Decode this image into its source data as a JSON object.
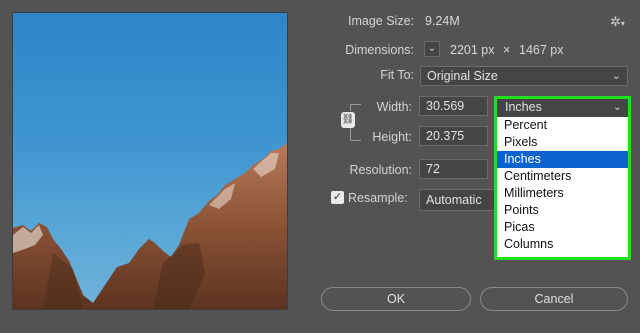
{
  "image_size": {
    "label": "Image Size:",
    "value": "9.24M"
  },
  "dimensions": {
    "label": "Dimensions:",
    "width": "2201 px",
    "times": "×",
    "height": "1467 px"
  },
  "fit_to": {
    "label": "Fit To:",
    "value": "Original Size"
  },
  "width": {
    "label": "Width:",
    "value": "30.569"
  },
  "height": {
    "label": "Height:",
    "value": "20.375"
  },
  "resolution": {
    "label": "Resolution:",
    "value": "72"
  },
  "resample": {
    "label": "Resample:",
    "value": "Automatic",
    "checked": true
  },
  "unit_dropdown": {
    "selected": "Inches",
    "highlight_color": "#24e01c",
    "options": [
      "Percent",
      "Pixels",
      "Inches",
      "Centimeters",
      "Millimeters",
      "Points",
      "Picas",
      "Columns"
    ]
  },
  "buttons": {
    "ok": "OK",
    "cancel": "Cancel"
  },
  "icons": {
    "settings": "gear-icon",
    "link": "link-icon",
    "dimensions_toggle": "chevron-down-icon"
  }
}
